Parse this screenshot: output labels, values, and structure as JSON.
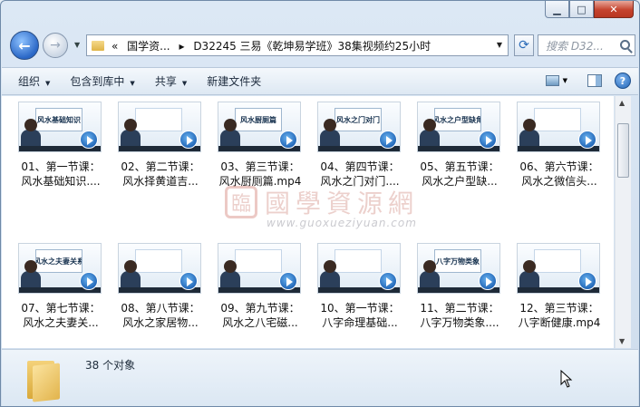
{
  "titlebar": {
    "minimize": "▁",
    "maximize": "□",
    "close": "✕"
  },
  "nav": {
    "back": "←",
    "forward": "→",
    "history_dropdown": "▼",
    "breadcrumb_chevron": "«",
    "breadcrumb_parent": "国学资...",
    "breadcrumb_sep": "▸",
    "breadcrumb_current": "D32245 三易《乾坤易学班》38集视频约25小时",
    "address_dropdown": "▼",
    "refresh": "⟳",
    "search_placeholder": "搜索 D32...",
    "search_icon": "search-icon"
  },
  "toolbar": {
    "organize": "组织",
    "include_in_library": "包含到库中",
    "share": "共享",
    "new_folder": "新建文件夹",
    "dropdown_glyph": "▼",
    "help": "?"
  },
  "files": [
    {
      "line1": "01、第一节课：",
      "line2": "风水基础知识....",
      "slide": "风水基础知识"
    },
    {
      "line1": "02、第二节课：",
      "line2": "风水择黄道吉...",
      "slide": ""
    },
    {
      "line1": "03、第三节课：",
      "line2": "风水厨厕篇.mp4",
      "slide": "风水厨厕篇"
    },
    {
      "line1": "04、第四节课：",
      "line2": "风水之门对门....",
      "slide": "风水之门对门"
    },
    {
      "line1": "05、第五节课：",
      "line2": "风水之户型缺...",
      "slide": "风水之户型缺角"
    },
    {
      "line1": "06、第六节课：",
      "line2": "风水之微信头...",
      "slide": ""
    },
    {
      "line1": "07、第七节课：",
      "line2": "风水之夫妻关...",
      "slide": "风水之夫妻关系"
    },
    {
      "line1": "08、第八节课：",
      "line2": "风水之家居物...",
      "slide": ""
    },
    {
      "line1": "09、第九节课：",
      "line2": "风水之八宅磁...",
      "slide": ""
    },
    {
      "line1": "10、第一节课：",
      "line2": "八字命理基础...",
      "slide": ""
    },
    {
      "line1": "11、第二节课：",
      "line2": "八字万物类象....",
      "slide": "八字万物类象"
    },
    {
      "line1": "12、第三节课：",
      "line2": "八字断健康.mp4",
      "slide": ""
    }
  ],
  "watermark": {
    "seal": "臨",
    "text": "國學資源網",
    "url": "www.guoxueziyuan.com"
  },
  "details": {
    "count": "38 个对象"
  },
  "scrollbar": {
    "up": "▲",
    "down": "▼"
  }
}
